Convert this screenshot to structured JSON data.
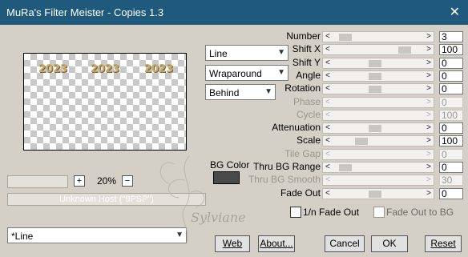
{
  "window": {
    "title": "MuRa's Filter Meister - Copies 1.3",
    "close_glyph": "✕"
  },
  "preview": {
    "years": [
      "2023",
      "2023",
      "2023"
    ]
  },
  "zoom": {
    "plus": "+",
    "value": "20%",
    "minus": "−"
  },
  "host": {
    "text": "Unknown Host (\"9PSP\")"
  },
  "combos": {
    "mode": "Line",
    "edge": "Wraparound",
    "order": "Behind"
  },
  "bg_color": {
    "label": "BG Color",
    "color": "#4a4a4a"
  },
  "params": [
    {
      "label": "Number",
      "value": "3",
      "enabled": true,
      "thumb": 0.08
    },
    {
      "label": "Shift X",
      "value": "100",
      "enabled": true,
      "thumb": 0.82
    },
    {
      "label": "Shift Y",
      "value": "0",
      "enabled": true,
      "thumb": 0.45
    },
    {
      "label": "Angle",
      "value": "0",
      "enabled": true,
      "thumb": 0.45
    },
    {
      "label": "Rotation",
      "value": "0",
      "enabled": true,
      "thumb": 0.45
    },
    {
      "label": "Phase",
      "value": "0",
      "enabled": false,
      "thumb": -1
    },
    {
      "label": "Cycle",
      "value": "100",
      "enabled": false,
      "thumb": -1
    },
    {
      "label": "Attenuation",
      "value": "0",
      "enabled": true,
      "thumb": 0.45
    },
    {
      "label": "Scale",
      "value": "100",
      "enabled": true,
      "thumb": 0.28
    },
    {
      "label": "Tile Gap",
      "value": "0",
      "enabled": false,
      "thumb": -1
    },
    {
      "label": "Thru BG Range",
      "value": "0",
      "enabled": true,
      "thumb": 0.08
    },
    {
      "label": "Thru BG Smooth",
      "value": "30",
      "enabled": false,
      "thumb": -1
    },
    {
      "label": "Fade Out",
      "value": "0",
      "enabled": true,
      "thumb": 0.45
    }
  ],
  "checkboxes": {
    "fade_1n": "1/n Fade Out",
    "fade_bg": "Fade Out to BG"
  },
  "preset": {
    "value": "*Line"
  },
  "buttons": {
    "web": "Web",
    "about": "About...",
    "cancel": "Cancel",
    "ok": "OK",
    "reset": "Reset"
  },
  "watermark": {
    "signature": "Sylviane"
  }
}
